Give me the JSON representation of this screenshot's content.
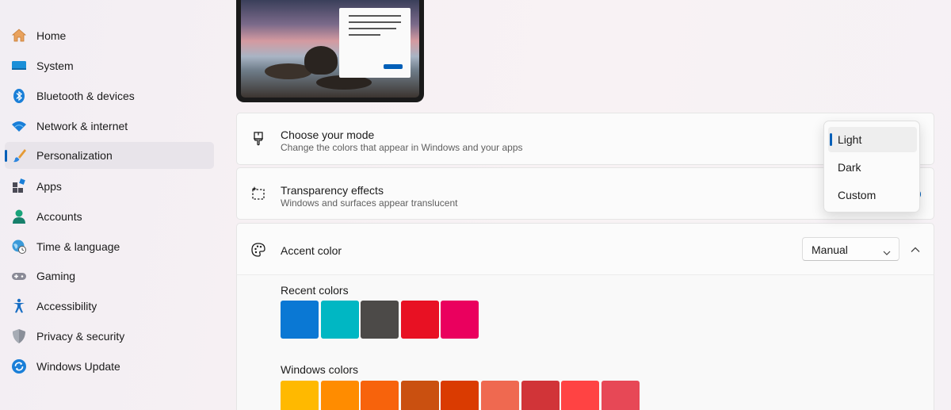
{
  "sidebar": {
    "items": [
      {
        "label": "Home",
        "icon": "home-icon"
      },
      {
        "label": "System",
        "icon": "system-icon"
      },
      {
        "label": "Bluetooth & devices",
        "icon": "bluetooth-icon"
      },
      {
        "label": "Network & internet",
        "icon": "wifi-icon"
      },
      {
        "label": "Personalization",
        "icon": "brush-icon",
        "active": true
      },
      {
        "label": "Apps",
        "icon": "apps-icon"
      },
      {
        "label": "Accounts",
        "icon": "person-icon"
      },
      {
        "label": "Time & language",
        "icon": "globe-clock-icon"
      },
      {
        "label": "Gaming",
        "icon": "gamepad-icon"
      },
      {
        "label": "Accessibility",
        "icon": "accessibility-icon"
      },
      {
        "label": "Privacy & security",
        "icon": "shield-icon"
      },
      {
        "label": "Windows Update",
        "icon": "update-icon"
      }
    ]
  },
  "mode_card": {
    "title": "Choose your mode",
    "subtitle": "Change the colors that appear in Windows and your apps",
    "options": [
      "Light",
      "Dark",
      "Custom"
    ],
    "selected": "Light"
  },
  "transparency_card": {
    "title": "Transparency effects",
    "subtitle": "Windows and surfaces appear translucent",
    "toggle_on": true
  },
  "accent_card": {
    "title": "Accent color",
    "select_value": "Manual",
    "recent_label": "Recent colors",
    "recent_colors": [
      "#0a78d4",
      "#00b7c3",
      "#4c4a48",
      "#e81123",
      "#ea005e"
    ],
    "windows_label": "Windows colors",
    "windows_colors": [
      "#ffb900",
      "#ff8c00",
      "#f7630c",
      "#ca5010",
      "#da3b01",
      "#ef6950",
      "#d13438",
      "#ff4343",
      "#e74856"
    ]
  },
  "colors": {
    "accent": "#005fb8"
  }
}
